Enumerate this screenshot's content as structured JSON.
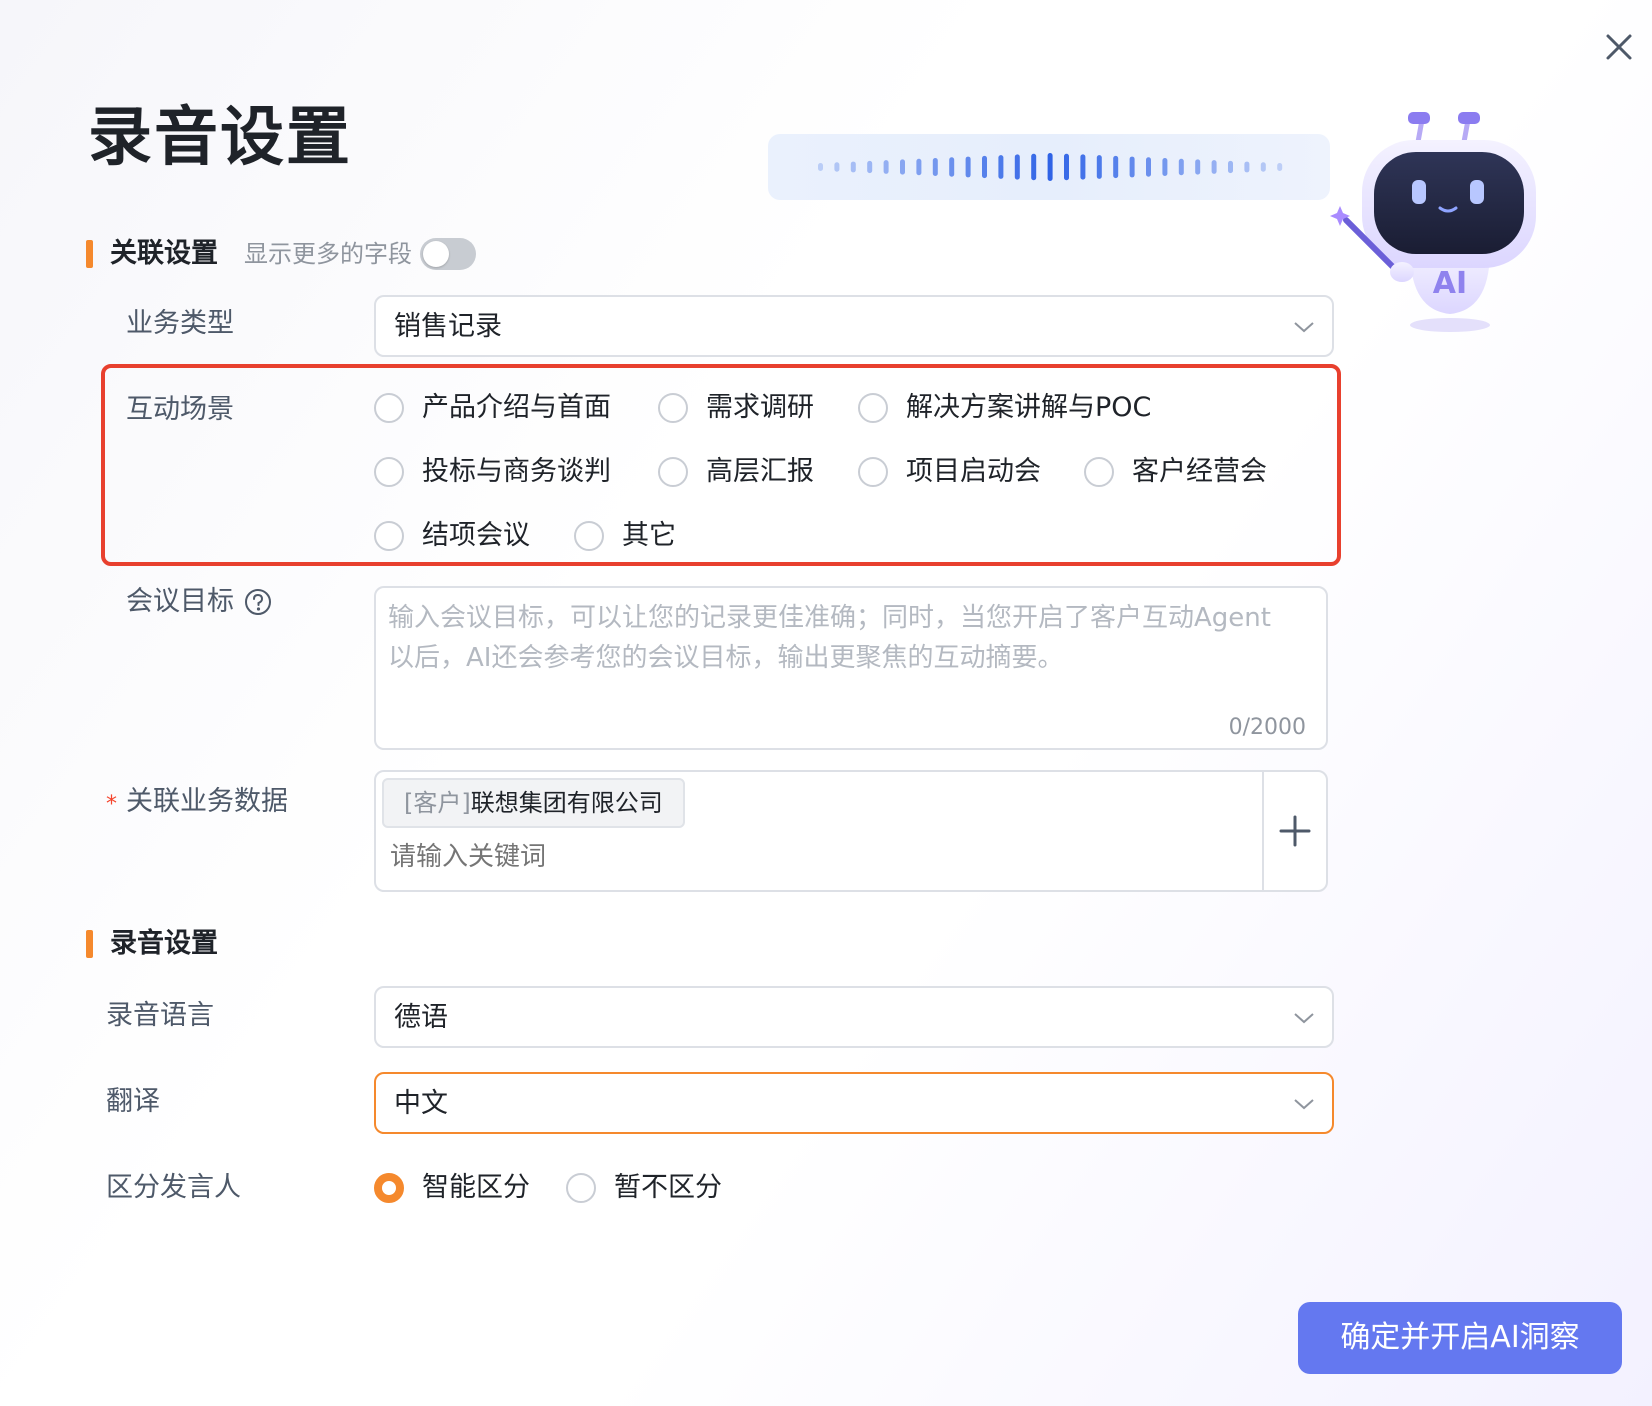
{
  "dialog": {
    "title": "录音设置",
    "close_icon": "close-icon",
    "confirm_label": "确定并开启AI洞察"
  },
  "association": {
    "section_title": "关联设置",
    "more_fields_hint": "显示更多的字段",
    "more_fields_on": false,
    "business_type": {
      "label": "业务类型",
      "value": "销售记录"
    },
    "scene": {
      "label": "互动场景",
      "options": [
        "产品介绍与首面",
        "需求调研",
        "解决方案讲解与POC",
        "投标与商务谈判",
        "高层汇报",
        "项目启动会",
        "客户经营会",
        "结项会议",
        "其它"
      ]
    },
    "goal": {
      "label": "会议目标",
      "help_icon": "help-icon",
      "placeholder": "输入会议目标，可以让您的记录更佳准确；同时，当您开启了客户互动Agent以后，AI还会参考您的会议目标，输出更聚焦的互动摘要。",
      "counter": "0/2000"
    },
    "related": {
      "required_mark": "*",
      "label": "关联业务数据",
      "tag_prefix": "[客户]",
      "tag_name": "联想集团有限公司",
      "placeholder": "请输入关键词",
      "add_icon": "plus-icon"
    }
  },
  "recording": {
    "section_title": "录音设置",
    "language": {
      "label": "录音语言",
      "value": "德语"
    },
    "translate": {
      "label": "翻译",
      "value": "中文"
    },
    "speaker": {
      "label": "区分发言人",
      "options": [
        "智能区分",
        "暂不区分"
      ],
      "selected": "智能区分"
    }
  },
  "colors": {
    "accent": "#f5892d",
    "primary": "#6478f0",
    "highlight": "#e8402e"
  }
}
